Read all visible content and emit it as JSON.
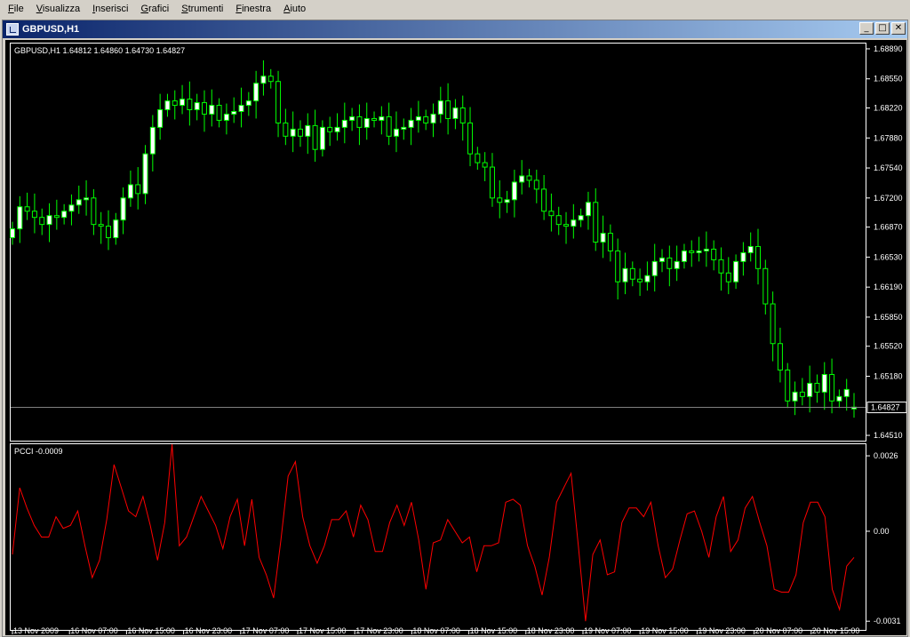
{
  "menu": [
    {
      "label": "File",
      "key": "F",
      "rest": "ile"
    },
    {
      "label": "Visualizza",
      "key": "V",
      "rest": "isualizza"
    },
    {
      "label": "Inserisci",
      "key": "I",
      "rest": "nserisci"
    },
    {
      "label": "Grafici",
      "key": "G",
      "rest": "rafici"
    },
    {
      "label": "Strumenti",
      "key": "S",
      "rest": "trumenti"
    },
    {
      "label": "Finestra",
      "key": "F",
      "rest": "inestra"
    },
    {
      "label": "Aiuto",
      "key": "A",
      "rest": "iuto"
    }
  ],
  "window": {
    "title": "GBPUSD,H1",
    "min_glyph": "_",
    "max_glyph": "□",
    "close_glyph": "✕"
  },
  "colors": {
    "background": "#000000",
    "candle_up": "#ffffff",
    "candle_down": "#000000",
    "wick": "#00ff00",
    "indicator": "#ff0000",
    "axis_text": "#ffffff",
    "grid_line": "#808080"
  },
  "chart_data": [
    {
      "type": "candlestick",
      "info_label": "GBPUSD,H1  1.64812 1.64860 1.64730 1.64827",
      "symbol": "GBPUSD",
      "timeframe": "H1",
      "last_ohlc": {
        "open": 1.64812,
        "high": 1.6486,
        "low": 1.6473,
        "close": 1.64827
      },
      "current_price": 1.64827,
      "current_price_label": "1.64827",
      "ylim": [
        1.6445,
        1.6895
      ],
      "y_ticks": [
        1.6889,
        1.6855,
        1.6822,
        1.6788,
        1.6754,
        1.672,
        1.6687,
        1.6653,
        1.6619,
        1.6585,
        1.6552,
        1.6518,
        1.6451
      ],
      "y_tick_labels": [
        "1.68890",
        "1.68550",
        "1.68220",
        "1.67880",
        "1.67540",
        "1.67200",
        "1.66870",
        "1.66530",
        "1.66190",
        "1.65850",
        "1.65520",
        "1.65180",
        "1.64510"
      ],
      "close": [
        1.6685,
        1.671,
        1.6705,
        1.6698,
        1.669,
        1.67,
        1.6698,
        1.6705,
        1.6712,
        1.6718,
        1.672,
        1.669,
        1.6688,
        1.6675,
        1.6695,
        1.672,
        1.6735,
        1.6725,
        1.677,
        1.68,
        1.682,
        1.683,
        1.6825,
        1.6832,
        1.682,
        1.6828,
        1.6815,
        1.6825,
        1.6808,
        1.6815,
        1.6818,
        1.6825,
        1.683,
        1.685,
        1.6858,
        1.6852,
        1.6805,
        1.679,
        1.6798,
        1.679,
        1.6802,
        1.6775,
        1.68,
        1.6795,
        1.68,
        1.6808,
        1.6812,
        1.68,
        1.681,
        1.6808,
        1.6812,
        1.679,
        1.6798,
        1.68,
        1.6808,
        1.6812,
        1.6805,
        1.6815,
        1.683,
        1.681,
        1.6822,
        1.6805,
        1.677,
        1.676,
        1.6755,
        1.672,
        1.6715,
        1.6718,
        1.6738,
        1.6745,
        1.674,
        1.673,
        1.6705,
        1.67,
        1.669,
        1.6688,
        1.6695,
        1.67,
        1.6715,
        1.667,
        1.668,
        1.666,
        1.6625,
        1.664,
        1.6628,
        1.6625,
        1.6632,
        1.6648,
        1.6652,
        1.664,
        1.6648,
        1.666,
        1.6658,
        1.666,
        1.6662,
        1.665,
        1.6635,
        1.6625,
        1.6648,
        1.6658,
        1.6665,
        1.664,
        1.66,
        1.6555,
        1.6525,
        1.649,
        1.65,
        1.6495,
        1.651,
        1.65,
        1.652,
        1.649,
        1.6495,
        1.6503,
        1.6483
      ],
      "open": [
        1.6675,
        1.6685,
        1.671,
        1.6705,
        1.6698,
        1.669,
        1.67,
        1.6698,
        1.6705,
        1.6712,
        1.6718,
        1.672,
        1.669,
        1.6688,
        1.6675,
        1.6695,
        1.672,
        1.6735,
        1.6725,
        1.677,
        1.68,
        1.682,
        1.683,
        1.6825,
        1.6832,
        1.682,
        1.6828,
        1.6815,
        1.6825,
        1.6808,
        1.6815,
        1.6818,
        1.6825,
        1.683,
        1.685,
        1.6858,
        1.6852,
        1.6805,
        1.679,
        1.6798,
        1.679,
        1.6802,
        1.6775,
        1.68,
        1.6795,
        1.68,
        1.6808,
        1.6812,
        1.68,
        1.681,
        1.6808,
        1.6812,
        1.679,
        1.6798,
        1.68,
        1.6808,
        1.6812,
        1.6805,
        1.6815,
        1.683,
        1.681,
        1.6822,
        1.6805,
        1.677,
        1.676,
        1.6755,
        1.672,
        1.6715,
        1.6718,
        1.6738,
        1.6745,
        1.674,
        1.673,
        1.6705,
        1.67,
        1.669,
        1.6688,
        1.6695,
        1.67,
        1.6715,
        1.667,
        1.668,
        1.666,
        1.6625,
        1.664,
        1.6628,
        1.6625,
        1.6632,
        1.6648,
        1.6652,
        1.664,
        1.6648,
        1.666,
        1.6658,
        1.666,
        1.6662,
        1.665,
        1.6635,
        1.6625,
        1.6648,
        1.6658,
        1.6665,
        1.664,
        1.66,
        1.6555,
        1.6525,
        1.649,
        1.65,
        1.6495,
        1.651,
        1.65,
        1.652,
        1.649,
        1.6495,
        1.6481
      ]
    },
    {
      "type": "line",
      "indicator_label": "PCCI -0.0009",
      "ylim": [
        -0.0034,
        0.003
      ],
      "y_ticks": [
        0.0026,
        0.0,
        -0.0031
      ],
      "y_tick_labels": [
        "0.0026",
        "0.00",
        "-0.0031"
      ],
      "values": [
        -0.0008,
        0.0015,
        0.0008,
        0.0002,
        -0.0002,
        -0.0002,
        0.0005,
        0.0001,
        0.0002,
        0.0007,
        -0.0005,
        -0.0016,
        -0.001,
        0.0004,
        0.0023,
        0.0015,
        0.0007,
        0.0005,
        0.0012,
        0.0002,
        -0.001,
        0.0003,
        0.003,
        -0.0005,
        -0.0002,
        0.0005,
        0.0012,
        0.0007,
        0.0002,
        -0.0006,
        0.0005,
        0.0011,
        -0.0005,
        0.0011,
        -0.0009,
        -0.0015,
        -0.0023,
        -0.0003,
        0.0019,
        0.0024,
        0.0005,
        -0.0005,
        -0.0011,
        -0.0005,
        0.0004,
        0.0004,
        0.0007,
        -0.0002,
        0.0009,
        0.0004,
        -0.0007,
        -0.0007,
        0.0003,
        0.0009,
        0.0002,
        0.001,
        -0.0003,
        -0.002,
        -0.0004,
        -0.0003,
        0.0004,
        0.0,
        -0.0004,
        -0.0002,
        -0.0014,
        -0.0005,
        -0.0005,
        -0.0004,
        0.001,
        0.0011,
        0.0009,
        -0.0005,
        -0.0012,
        -0.0022,
        -0.0009,
        0.001,
        0.0015,
        0.002,
        -0.0005,
        -0.0031,
        -0.0008,
        -0.0003,
        -0.0015,
        -0.0014,
        0.0003,
        0.0008,
        0.0008,
        0.0005,
        0.001,
        -0.0005,
        -0.0016,
        -0.0013,
        -0.0003,
        0.0006,
        0.0007,
        0.0,
        -0.0009,
        0.0005,
        0.0012,
        -0.0007,
        -0.0003,
        0.0008,
        0.0012,
        0.0003,
        -0.0005,
        -0.002,
        -0.0021,
        -0.0021,
        -0.0015,
        0.0003,
        0.001,
        0.001,
        0.0005,
        -0.002,
        -0.0027,
        -0.0012,
        -0.0009
      ]
    }
  ],
  "x_axis": {
    "labels": [
      "13 Nov 2009",
      "16 Nov 07:00",
      "16 Nov 15:00",
      "16 Nov 23:00",
      "17 Nov 07:00",
      "17 Nov 15:00",
      "17 Nov 23:00",
      "18 Nov 07:00",
      "18 Nov 15:00",
      "18 Nov 23:00",
      "19 Nov 07:00",
      "19 Nov 15:00",
      "19 Nov 23:00",
      "20 Nov 07:00",
      "20 Nov 15:00"
    ]
  }
}
